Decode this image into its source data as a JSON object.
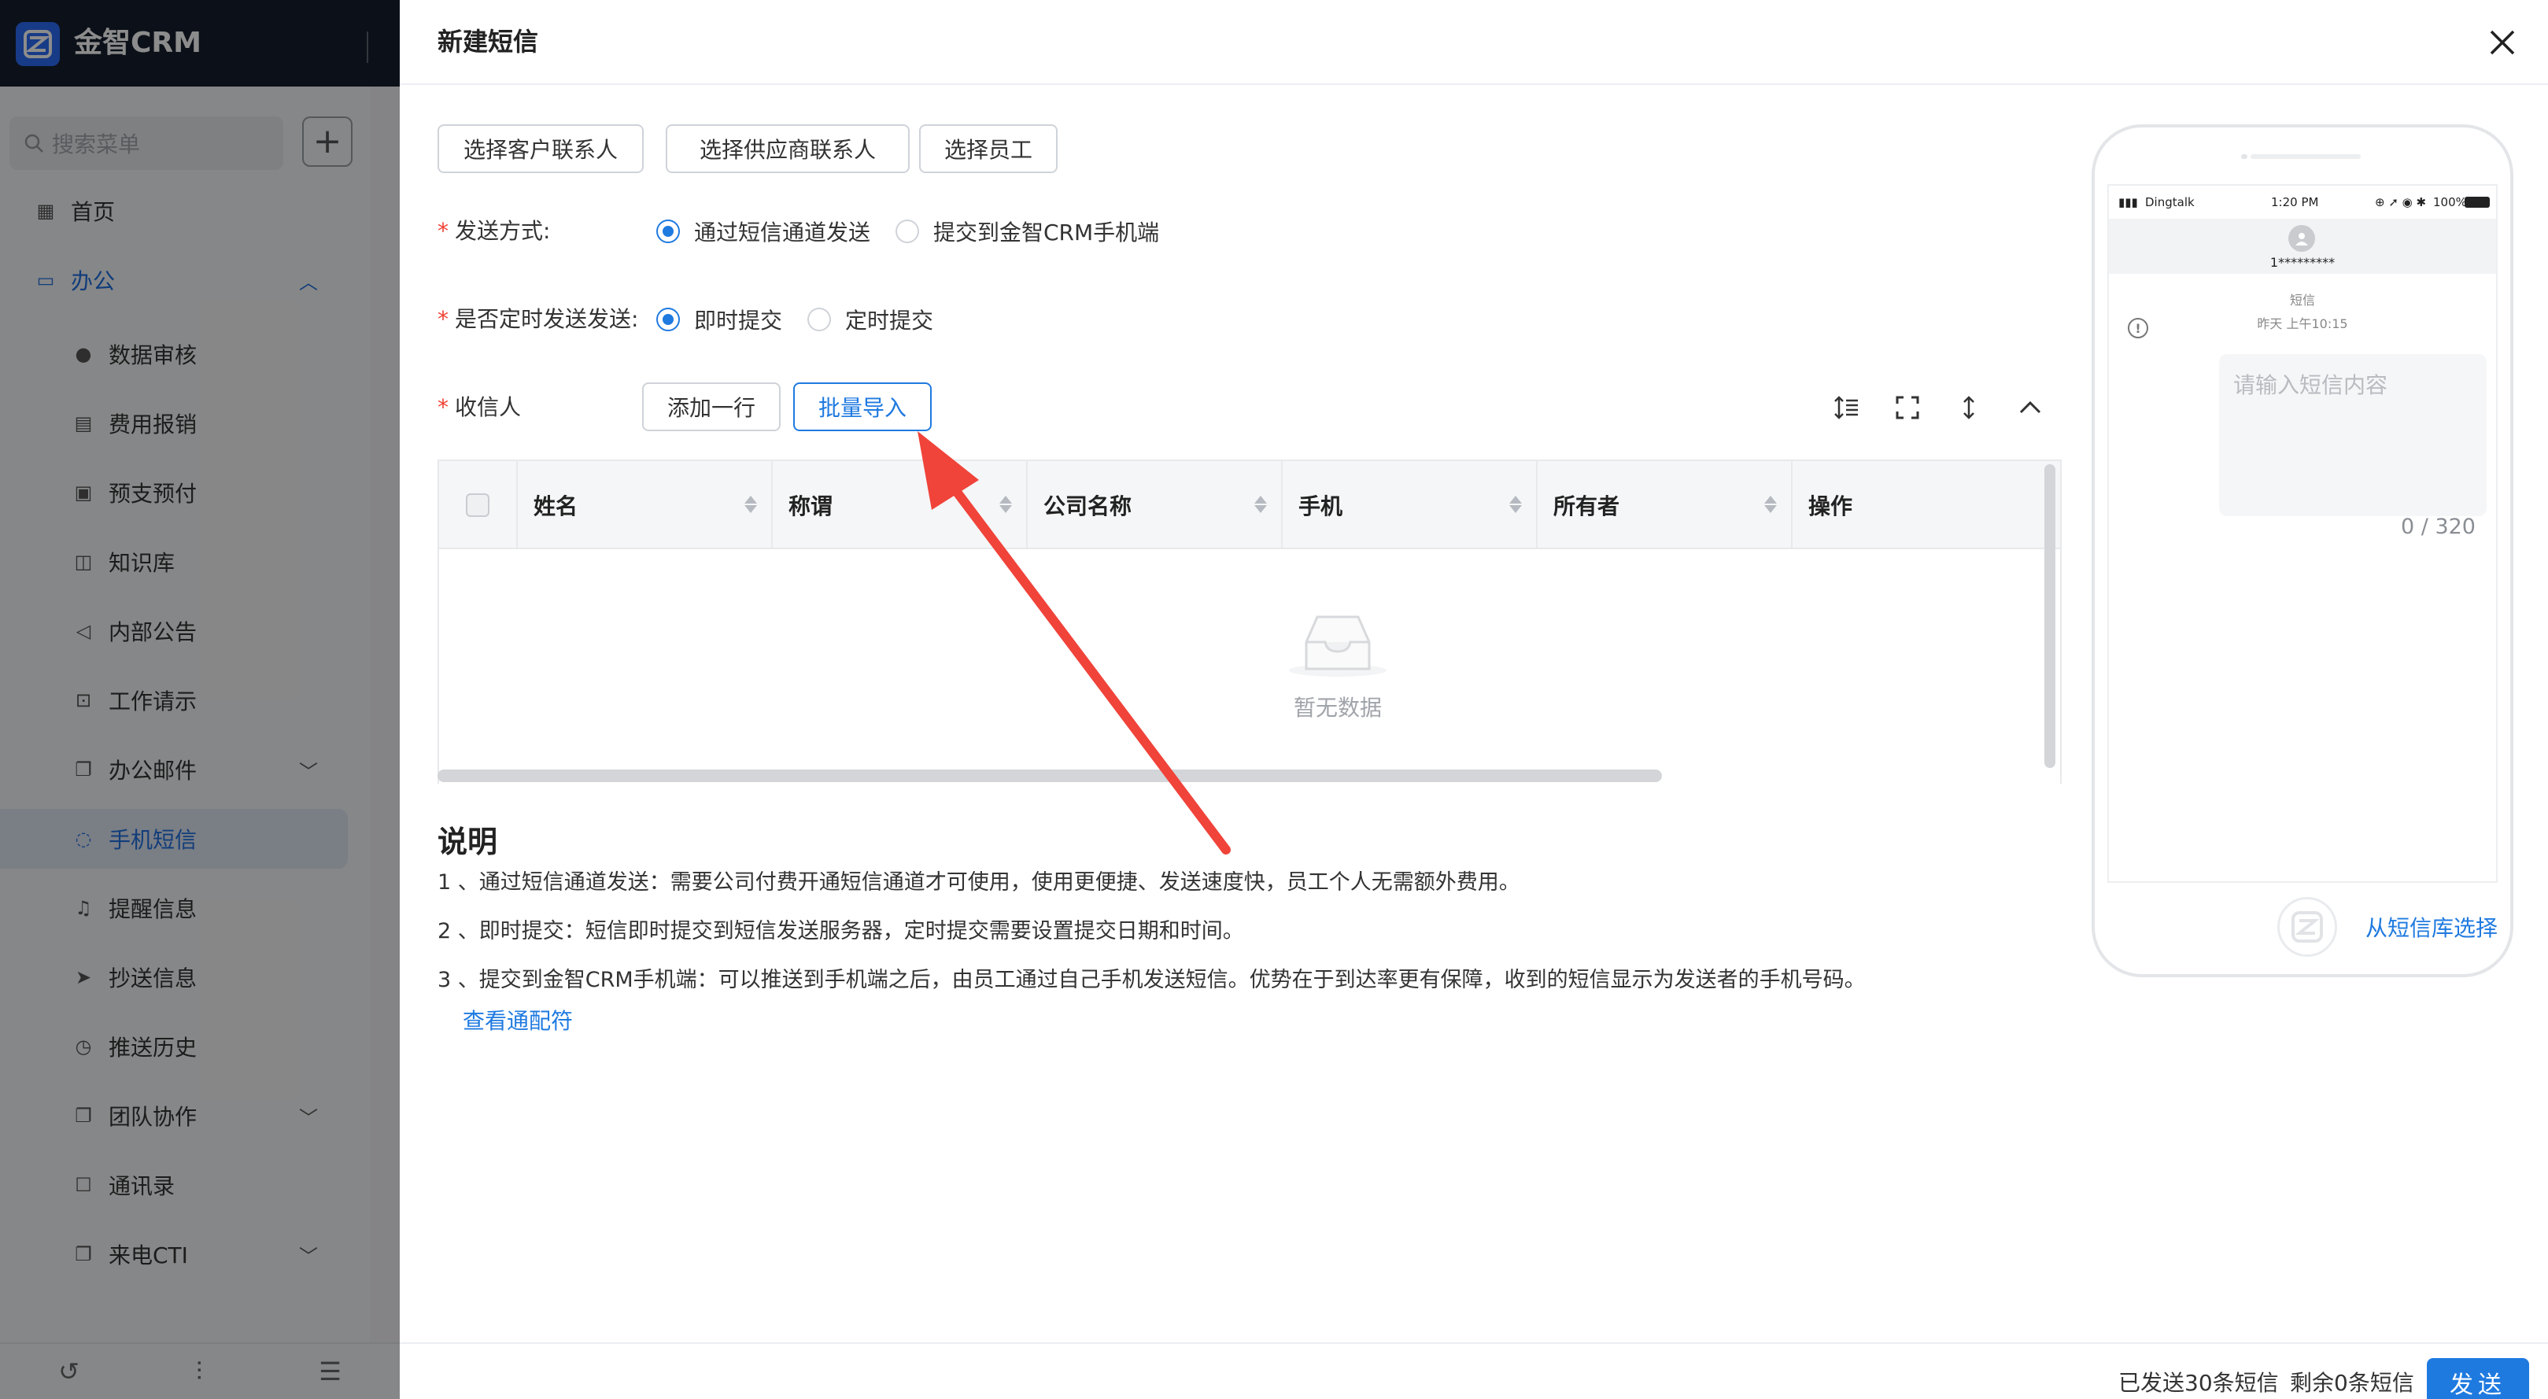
{
  "app": {
    "name": "金智CRM",
    "search_placeholder": "搜索菜单",
    "add_symbol": "+"
  },
  "sidebar": {
    "items": [
      {
        "label": "首页"
      },
      {
        "label": "办公"
      },
      {
        "label": "数据审核"
      },
      {
        "label": "费用报销"
      },
      {
        "label": "预支预付"
      },
      {
        "label": "知识库"
      },
      {
        "label": "内部公告"
      },
      {
        "label": "工作请示"
      },
      {
        "label": "办公邮件"
      },
      {
        "label": "手机短信"
      },
      {
        "label": "提醒信息"
      },
      {
        "label": "抄送信息"
      },
      {
        "label": "推送历史"
      },
      {
        "label": "团队协作"
      },
      {
        "label": "通讯录"
      },
      {
        "label": "来电CTI"
      }
    ]
  },
  "drawer": {
    "title": "新建短信",
    "buttons": {
      "customer_contacts": "选择客户联系人",
      "supplier_contacts": "选择供应商联系人",
      "employees": "选择员工"
    },
    "send_method": {
      "label": "发送方式:",
      "options": [
        "通过短信通道发送",
        "提交到金智CRM手机端"
      ],
      "selected": "通过短信通道发送"
    },
    "timing": {
      "label": "是否定时发送发送:",
      "options": [
        "即时提交",
        "定时提交"
      ],
      "selected": "即时提交"
    },
    "recipients": {
      "label": "收信人",
      "add_row": "添加一行",
      "bulk_import": "批量导入"
    },
    "table": {
      "columns": [
        "姓名",
        "称谓",
        "公司名称",
        "手机",
        "所有者",
        "操作"
      ],
      "empty_text": "暂无数据"
    },
    "notes": {
      "title": "说明",
      "items": [
        "1 、通过短信通道发送：需要公司付费开通短信通道才可使用，使用更便捷、发送速度快，员工个人无需额外费用。",
        "2 、即时提交：短信即时提交到短信发送服务器，定时提交需要设置提交日期和时间。",
        "3 、提交到金智CRM手机端：可以推送到手机端之后，由员工通过自己手机发送短信。优势在于到达率更有保障，收到的短信显示为发送者的手机号码。"
      ],
      "link": "查看通配符"
    },
    "preview": {
      "carrier": "Dingtalk",
      "time": "1:20 PM",
      "battery": "100%",
      "contact": "1*********",
      "msg_type": "短信",
      "msg_time": "昨天 上午10:15",
      "placeholder": "请输入短信内容",
      "counter": "0 / 320",
      "library_link": "从短信库选择"
    },
    "footer": {
      "sent": "已发送30条短信",
      "remaining": "剩余0条短信",
      "send": "发送"
    }
  },
  "colors": {
    "primary": "#1f7ae0",
    "required": "#f04134",
    "annotation_arrow": "#f0433a",
    "topbar": "#16202e"
  }
}
